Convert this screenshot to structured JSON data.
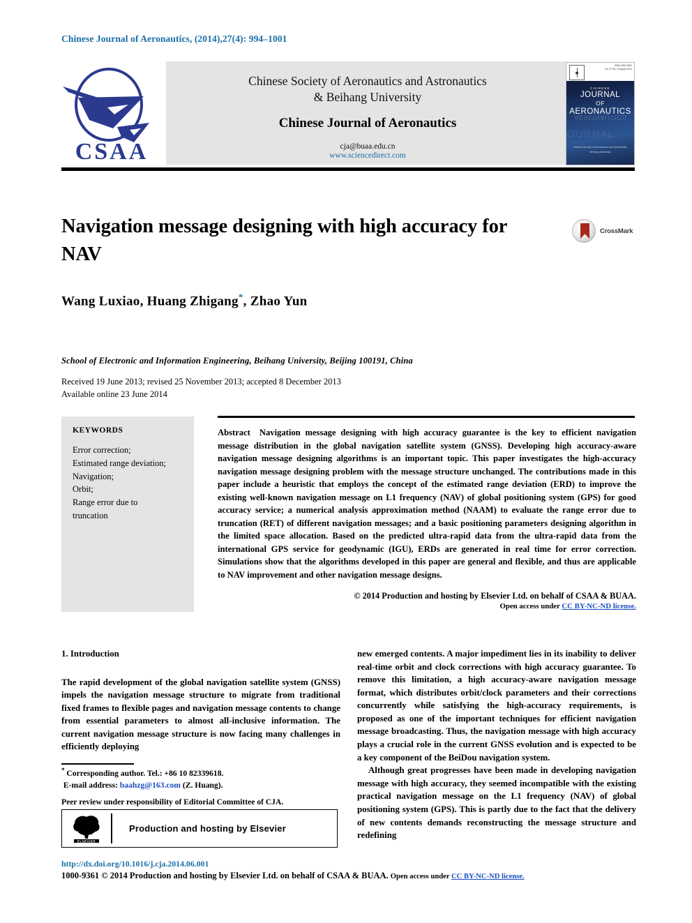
{
  "running_head": "Chinese Journal of Aeronautics, (2014),27(4): 994–1001",
  "masthead": {
    "logo_text": "CSAA",
    "society_line1": "Chinese Society of Aeronautics and Astronautics",
    "society_line2": "& Beihang University",
    "journal_name": "Chinese Journal of Aeronautics",
    "email": "cja@buaa.edu.cn",
    "website": "www.sciencedirect.com",
    "cover": {
      "publisher": "ELSEVIER",
      "issn": "ISSN 1000-9361",
      "volume": "Vol. 27 No. 4  August 2014",
      "chinese_label": "CHINESE",
      "title_line1": "JOURNAL",
      "title_line2": "OF",
      "title_line3": "AERONAUTICS",
      "foot_line1": "Chinese Society of Aeronautics and Astronautics",
      "foot_line2": "Beihang University"
    }
  },
  "article": {
    "title": "Navigation message designing with high accuracy for NAV",
    "crossmark_label": "CrossMark",
    "authors": "Wang Luxiao, Huang Zhigang",
    "authors_tail": ", Zhao Yun",
    "corresponding_marker": "*",
    "affiliation": "School of Electronic and Information Engineering, Beihang University, Beijing 100191, China",
    "received_line": "Received 19 June 2013; revised 25 November 2013; accepted 8 December 2013",
    "available_line": "Available online 23 June 2014"
  },
  "keywords": {
    "heading": "KEYWORDS",
    "items": "Error correction;\nEstimated range deviation;\nNavigation;\nOrbit;\nRange error due to\ntruncation"
  },
  "abstract": {
    "label": "Abstract",
    "text": "Navigation message designing with high accuracy guarantee is the key to efficient navigation message distribution in the global navigation satellite system (GNSS). Developing high accuracy-aware navigation message designing algorithms is an important topic. This paper investigates the high-accuracy navigation message designing problem with the message structure unchanged. The contributions made in this paper include a heuristic that employs the concept of the estimated range deviation (ERD) to improve the existing well-known navigation message on L1 frequency (NAV) of global positioning system (GPS) for good accuracy service; a numerical analysis approximation method (NAAM) to evaluate the range error due to truncation (RET) of different navigation messages; and a basic positioning parameters designing algorithm in the limited space allocation. Based on the predicted ultra-rapid data from the ultra-rapid data from the international GPS service for geodynamic (IGU), ERDs are generated in real time for error correction. Simulations show that the algorithms developed in this paper are general and flexible, and thus are applicable to NAV improvement and other navigation message designs.",
    "copyright": "© 2014 Production and hosting by Elsevier Ltd. on behalf of CSAA & BUAA.",
    "open_access_prefix": "Open access under ",
    "open_access_link": "CC BY-NC-ND license."
  },
  "body": {
    "section_heading": "1. Introduction",
    "left_paragraph": "The rapid development of the global navigation satellite system (GNSS) impels the navigation message structure to migrate from traditional fixed frames to flexible pages and navigation message contents to change from essential parameters to almost all-inclusive information. The current navigation message structure is now facing many challenges in efficiently deploying",
    "right_paragraph_1": "new emerged contents. A major impediment lies in its inability to deliver real-time orbit and clock corrections with high accuracy guarantee. To remove this limitation, a high accuracy-aware navigation message format, which distributes orbit/clock parameters and their corrections concurrently while satisfying the high-accuracy requirements, is proposed as one of the important techniques for efficient navigation message broadcasting. Thus, the navigation message with high accuracy plays a crucial role in the current GNSS evolution and is expected to be a key component of the BeiDou navigation system.",
    "right_paragraph_2": "Although great progresses have been made in developing navigation message with high accuracy, they seemed incompatible with the existing practical navigation message on the L1 frequency (NAV) of global positioning system (GPS). This is partly due to the fact that the delivery of new contents demands reconstructing the message structure and redefining"
  },
  "footnotes": {
    "corresponding": "Corresponding author. Tel.: +86 10 82339618.",
    "email_label": "E-mail address: ",
    "email_value": "baahzg@163.com",
    "email_suffix": " (Z. Huang).",
    "peer_review": "Peer review under responsibility of Editorial Committee of CJA.",
    "elsevier_banner": "Production and hosting by Elsevier",
    "elsevier_logo_text": "ELSEVIER"
  },
  "bottom": {
    "doi": "http://dx.doi.org/10.1016/j.cja.2014.06.001",
    "issn_copy": "1000-9361 © 2014 Production and hosting by Elsevier Ltd. on behalf of CSAA & BUAA. ",
    "open_access_prefix": "Open access under ",
    "open_access_link": "CC BY-NC-ND license."
  },
  "colors": {
    "link_blue": "#1a6fa8",
    "cc_blue": "#1a4fc4",
    "panel_gray": "#e4e4e4",
    "crossmark_red": "#a8281e",
    "logo_navy": "#2b3a8f"
  }
}
